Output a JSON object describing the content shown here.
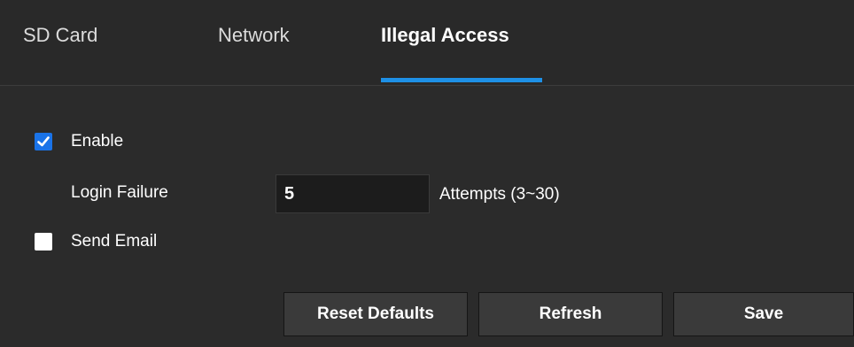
{
  "tabs": [
    {
      "label": "SD Card"
    },
    {
      "label": "Network"
    },
    {
      "label": "Illegal Access",
      "active": true
    }
  ],
  "accent_color": "#1e90e6",
  "form": {
    "enable": {
      "label": "Enable",
      "checked": true
    },
    "login_failure": {
      "label": "Login Failure",
      "value": "5",
      "suffix": "Attempts (3~30)"
    },
    "send_email": {
      "label": "Send Email",
      "checked": false
    }
  },
  "buttons": {
    "reset_defaults": "Reset Defaults",
    "refresh": "Refresh",
    "save": "Save"
  }
}
